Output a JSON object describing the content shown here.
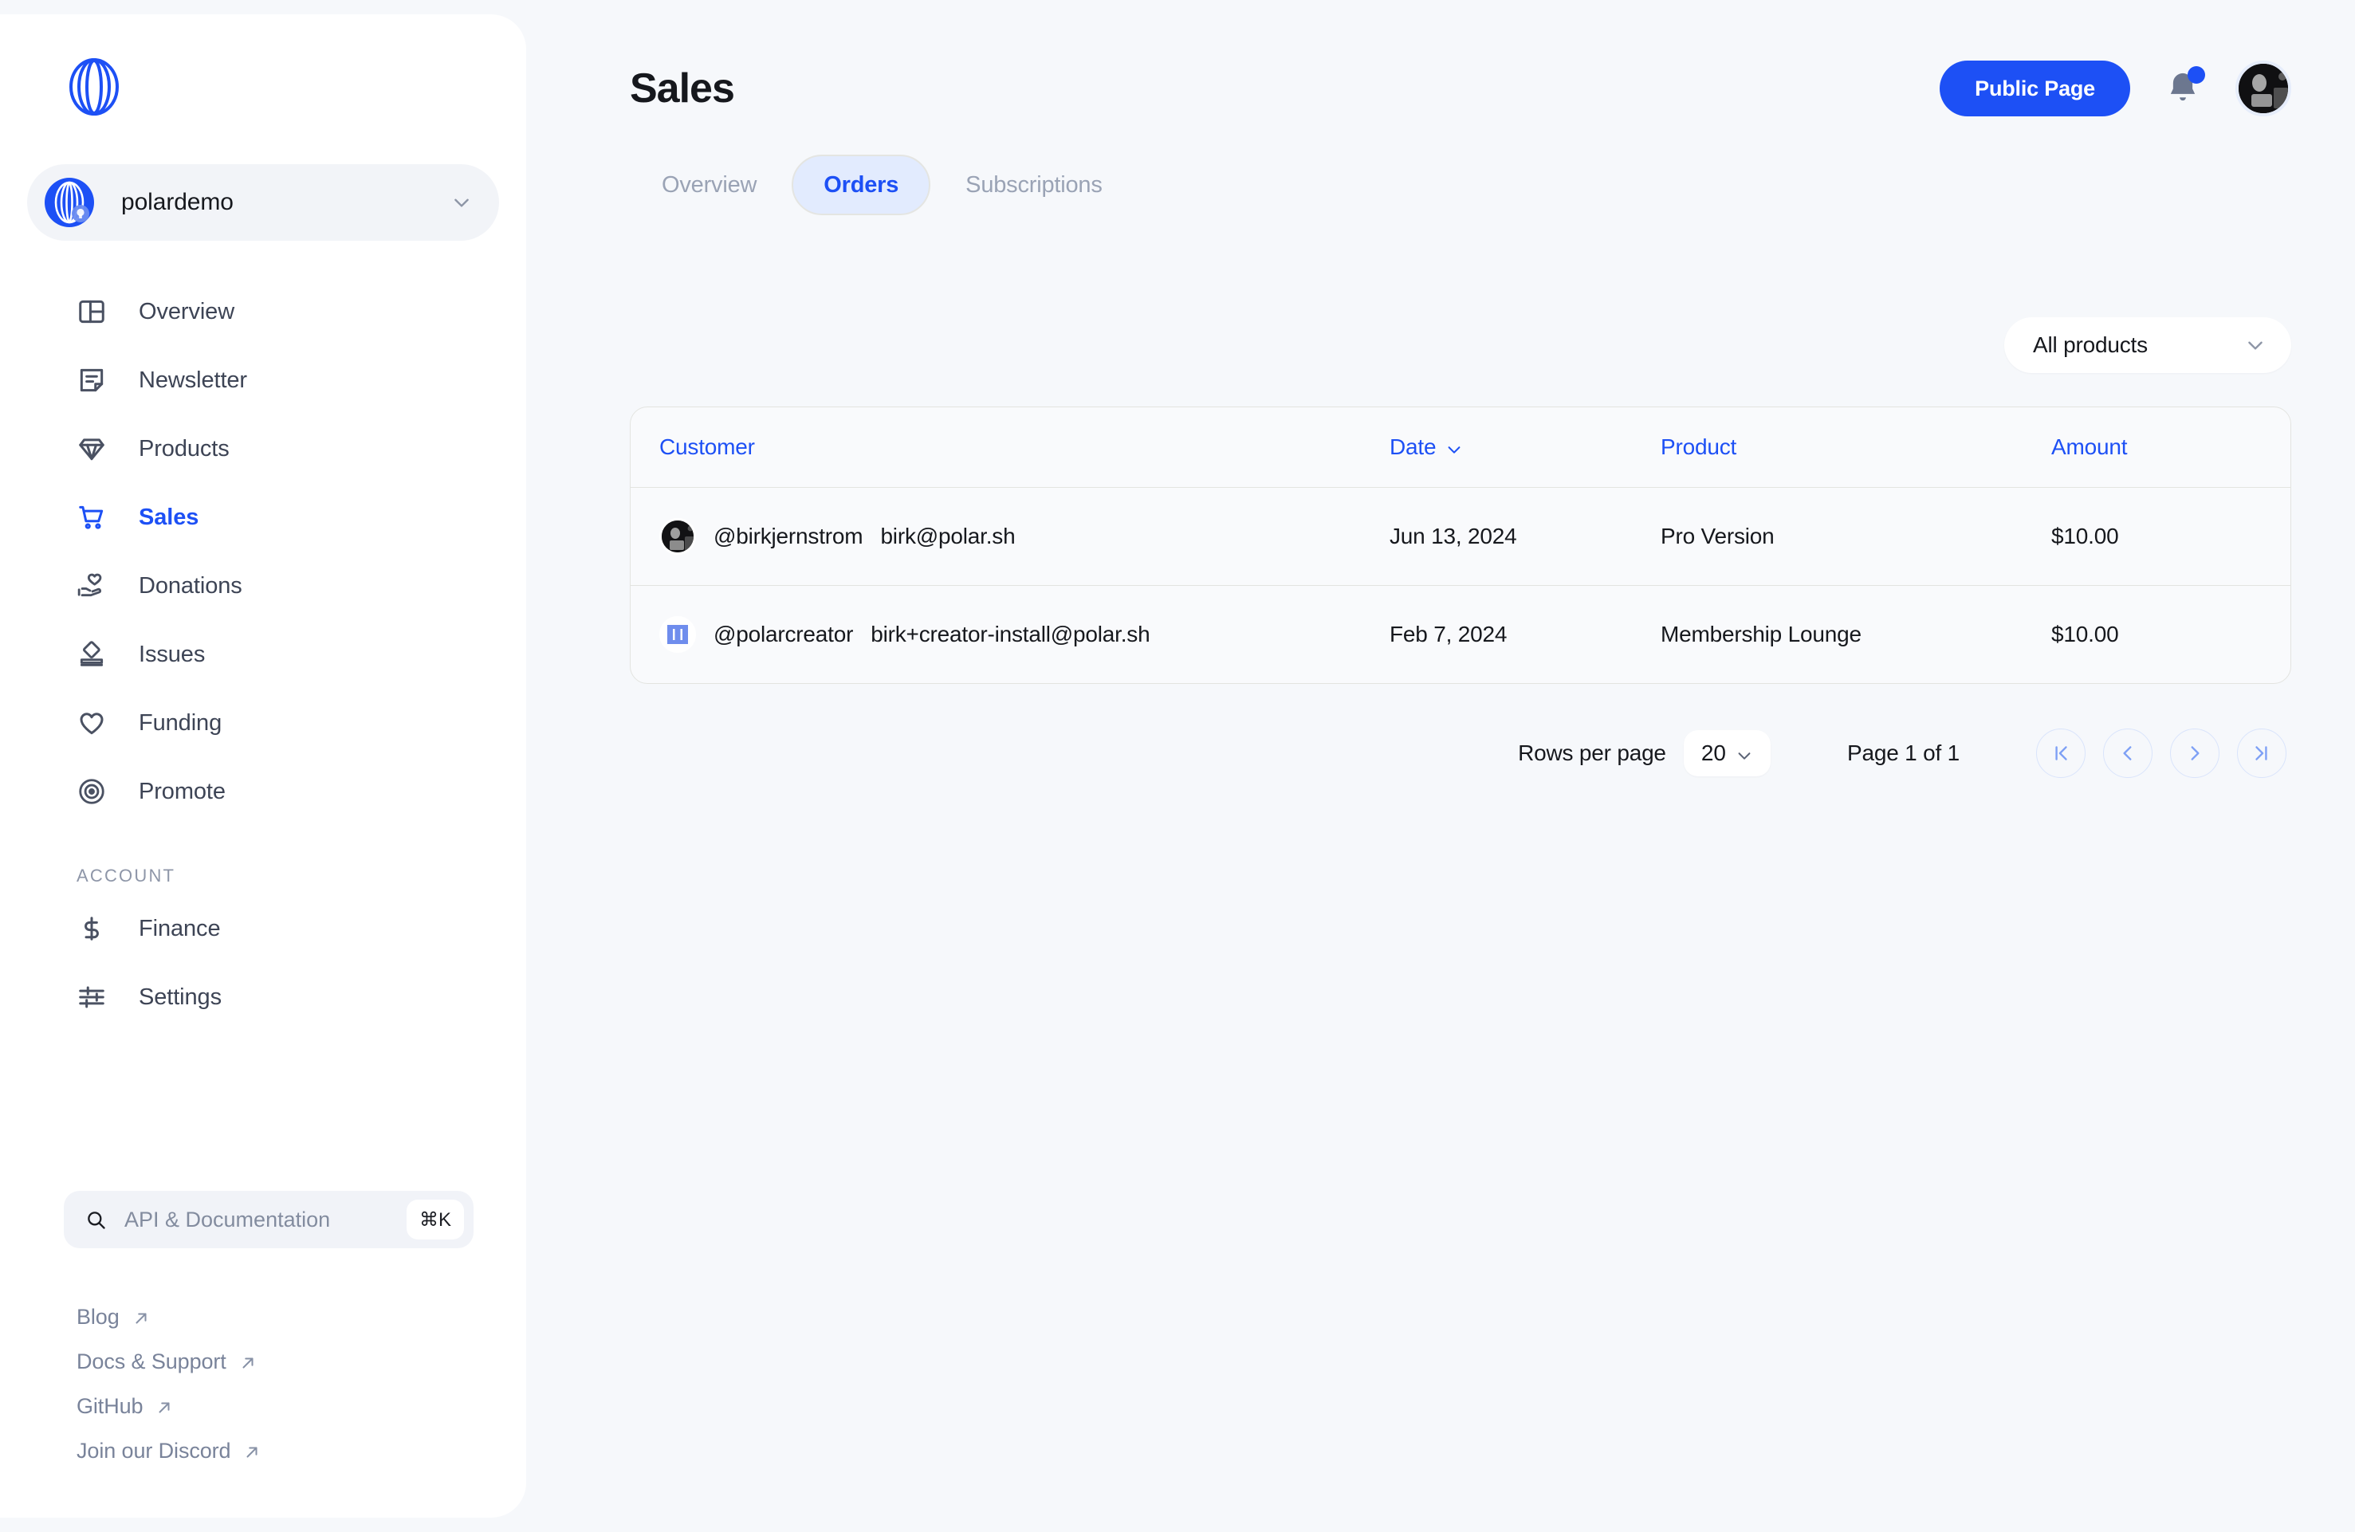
{
  "sidebar": {
    "logo_icon": "polar-logo-icon",
    "org": {
      "name": "polardemo",
      "avatar_icon": "polar-org-avatar",
      "chevron_icon": "chevron-down-icon"
    },
    "nav": [
      {
        "label": "Overview",
        "icon": "layout-panel-icon",
        "active": false
      },
      {
        "label": "Newsletter",
        "icon": "note-text-icon",
        "active": false
      },
      {
        "label": "Products",
        "icon": "diamond-icon",
        "active": false
      },
      {
        "label": "Sales",
        "icon": "shopping-cart-icon",
        "active": true
      },
      {
        "label": "Donations",
        "icon": "hand-heart-icon",
        "active": false
      },
      {
        "label": "Issues",
        "icon": "badge-stand-icon",
        "active": false
      },
      {
        "label": "Funding",
        "icon": "heart-icon",
        "active": false
      },
      {
        "label": "Promote",
        "icon": "broadcast-icon",
        "active": false
      }
    ],
    "account_section_label": "ACCOUNT",
    "account_nav": [
      {
        "label": "Finance",
        "icon": "dollar-icon",
        "active": false
      },
      {
        "label": "Settings",
        "icon": "sliders-icon",
        "active": false
      }
    ],
    "search": {
      "placeholder": "API & Documentation",
      "value": "",
      "icon": "search-icon",
      "shortcut": "⌘K"
    },
    "footer_links": [
      {
        "label": "Blog",
        "icon": "external-link-icon"
      },
      {
        "label": "Docs & Support",
        "icon": "external-link-icon"
      },
      {
        "label": "GitHub",
        "icon": "external-link-icon"
      },
      {
        "label": "Join our Discord",
        "icon": "external-link-icon"
      }
    ]
  },
  "header": {
    "title": "Sales",
    "public_page_label": "Public Page",
    "notifications_icon": "bell-icon",
    "has_unread": true,
    "avatar_icon": "user-avatar"
  },
  "tabs": [
    {
      "label": "Overview",
      "active": false
    },
    {
      "label": "Orders",
      "active": true
    },
    {
      "label": "Subscriptions",
      "active": false
    }
  ],
  "filters": {
    "product_select_value": "All products",
    "chevron_icon": "chevron-down-icon"
  },
  "table": {
    "columns": [
      {
        "key": "customer",
        "label": "Customer",
        "sortable": false
      },
      {
        "key": "date",
        "label": "Date",
        "sortable": true,
        "sort_icon": "chevron-down-icon"
      },
      {
        "key": "product",
        "label": "Product",
        "sortable": false
      },
      {
        "key": "amount",
        "label": "Amount",
        "sortable": false
      }
    ],
    "rows": [
      {
        "avatar_icon": "photo-avatar",
        "handle": "@birkjernstrom",
        "email": "birk@polar.sh",
        "date": "Jun 13, 2024",
        "product": "Pro Version",
        "amount": "$10.00"
      },
      {
        "avatar_icon": "polar-avatar",
        "handle": "@polarcreator",
        "email": "birk+creator-install@polar.sh",
        "date": "Feb 7, 2024",
        "product": "Membership Lounge",
        "amount": "$10.00"
      }
    ]
  },
  "pagination": {
    "rows_per_page_label": "Rows per page",
    "rows_per_page_value": "20",
    "page_indicator": "Page 1 of 1",
    "first_icon": "chevron-first-icon",
    "prev_icon": "chevron-left-icon",
    "next_icon": "chevron-right-icon",
    "last_icon": "chevron-last-icon"
  },
  "colors": {
    "accent": "#1d50f5",
    "page_bg": "#f6f8fb",
    "sidebar_bg": "#ffffff",
    "muted_text": "#9aa3b5",
    "border": "#e3e4e0"
  }
}
